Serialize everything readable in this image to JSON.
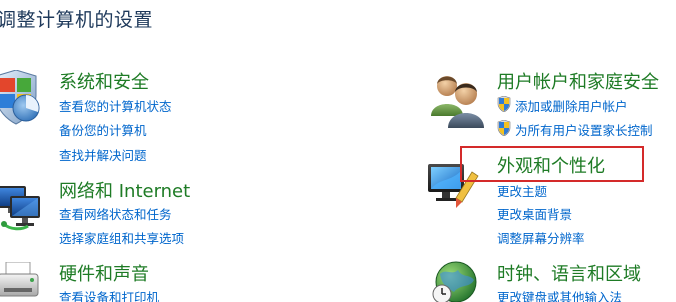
{
  "page": {
    "title": "调整计算机的设置"
  },
  "categories": {
    "system_security": {
      "title": "系统和安全",
      "links": [
        "查看您的计算机状态",
        "备份您的计算机",
        "查找并解决问题"
      ]
    },
    "network": {
      "title": "网络和 Internet",
      "links": [
        "查看网络状态和任务",
        "选择家庭组和共享选项"
      ]
    },
    "hardware_sound": {
      "title": "硬件和声音",
      "links": [
        "查看设备和打印机"
      ]
    },
    "user_accounts": {
      "title": "用户帐户和家庭安全",
      "links": [
        "添加或删除用户帐户",
        "为所有用户设置家长控制"
      ]
    },
    "appearance": {
      "title": "外观和个性化",
      "links": [
        "更改主题",
        "更改桌面背景",
        "调整屏幕分辨率"
      ]
    },
    "clock_language": {
      "title": "时钟、语言和区域",
      "links": [
        "更改键盘或其他输入法"
      ]
    }
  },
  "colors": {
    "category_title": "#1e7b25",
    "link": "#0066cc",
    "highlight": "#d42a2a"
  }
}
